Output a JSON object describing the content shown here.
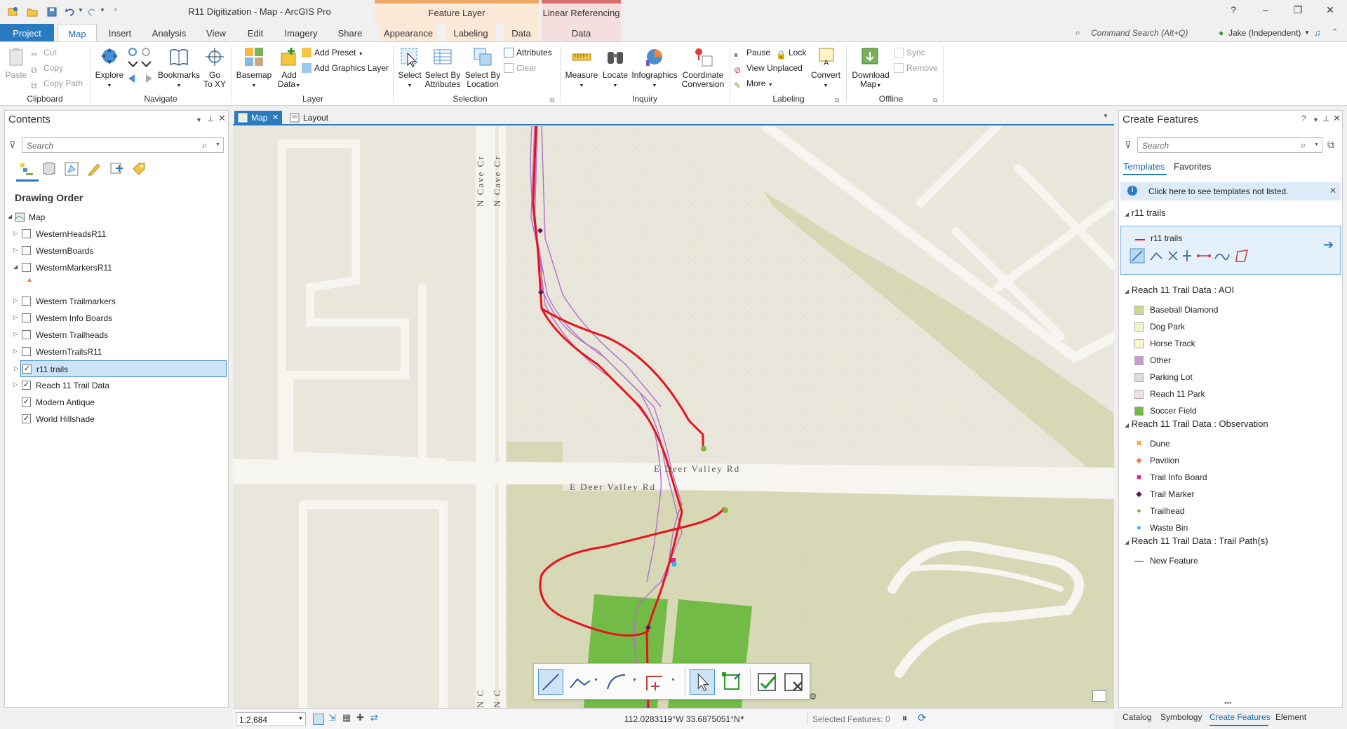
{
  "window": {
    "title": "R11 Digitization - Map - ArcGIS Pro",
    "context_feature_layer": "Feature Layer",
    "context_linear_ref": "Linear Referencing",
    "help": "?",
    "minimize": "–",
    "restore": "❐",
    "close": "✕"
  },
  "tabs": {
    "project": "Project",
    "map": "Map",
    "insert": "Insert",
    "analysis": "Analysis",
    "view": "View",
    "edit": "Edit",
    "imagery": "Imagery",
    "share": "Share",
    "appearance": "Appearance",
    "labeling": "Labeling",
    "data": "Data",
    "lr_data": "Data"
  },
  "command_search": {
    "placeholder": "Command Search (Alt+Q)"
  },
  "user": {
    "name": "Jake (Independent)"
  },
  "ribbon": {
    "clipboard": {
      "label": "Clipboard",
      "paste": "Paste",
      "cut": "Cut",
      "copy": "Copy",
      "copy_path": "Copy Path"
    },
    "navigate": {
      "label": "Navigate",
      "explore": "Explore",
      "bookmarks": "Bookmarks",
      "goto": "Go",
      "goto2": "To XY"
    },
    "layer": {
      "label": "Layer",
      "basemap": "Basemap",
      "add_data": "Add",
      "add_data2": "Data",
      "add_preset": "Add Preset",
      "add_graphics": "Add Graphics Layer"
    },
    "selection": {
      "label": "Selection",
      "select": "Select",
      "by_attr": "Select By",
      "by_attr2": "Attributes",
      "by_loc": "Select By",
      "by_loc2": "Location",
      "attributes": "Attributes",
      "clear": "Clear"
    },
    "inquiry": {
      "label": "Inquiry",
      "measure": "Measure",
      "locate": "Locate",
      "infographics": "Infographics",
      "coord": "Coordinate",
      "coord2": "Conversion"
    },
    "labeling": {
      "label": "Labeling",
      "pause": "Pause",
      "lock": "Lock",
      "view_unplaced": "View Unplaced",
      "more": "More",
      "convert": "Convert"
    },
    "offline": {
      "label": "Offline",
      "download": "Download",
      "download2": "Map",
      "sync": "Sync",
      "remove": "Remove"
    }
  },
  "contents": {
    "title": "Contents",
    "search_placeholder": "Search",
    "drawing_order": "Drawing Order",
    "map_node": "Map",
    "layers": [
      {
        "name": "WesternHeadsR11",
        "checked": false,
        "expanded": false
      },
      {
        "name": "WesternBoards",
        "checked": false,
        "expanded": false
      },
      {
        "name": "WesternMarkersR11",
        "checked": false,
        "expanded": true
      },
      {
        "name": "Western Trailmarkers",
        "checked": false,
        "expanded": false
      },
      {
        "name": "Western Info Boards",
        "checked": false,
        "expanded": false
      },
      {
        "name": "Western Trailheads",
        "checked": false,
        "expanded": false
      },
      {
        "name": "WesternTrailsR11",
        "checked": false,
        "expanded": false
      },
      {
        "name": "r11 trails",
        "checked": true,
        "expanded": false,
        "selected": true
      },
      {
        "name": "Reach 11 Trail Data",
        "checked": true,
        "expanded": false
      },
      {
        "name": "Modern Antique",
        "checked": true,
        "expanded": null
      },
      {
        "name": "World Hillshade",
        "checked": true,
        "expanded": null
      }
    ]
  },
  "view_tabs": {
    "map": "Map",
    "layout": "Layout"
  },
  "map": {
    "road_labels": [
      "E Deer Valley Rd",
      "E Deer Valley Rd",
      "N Cave Cr",
      "N Cave Cr",
      "N C",
      "N C"
    ],
    "colors": {
      "trail": "#e8121b",
      "path": "#b070c8",
      "park": "#d7d9b6",
      "field": "#72bb46",
      "road": "#f7f5ef",
      "ground": "#e9e6dc"
    }
  },
  "status": {
    "scale": "1:2,684",
    "coords": "112.0283119°W 33.6875051°N",
    "selected": "Selected Features: 0"
  },
  "create_features": {
    "title": "Create Features",
    "search_placeholder": "Search",
    "tab_templates": "Templates",
    "tab_favorites": "Favorites",
    "info": "Click here to see templates not listed.",
    "group_r11": "r11 trails",
    "r11_template": "r11 trails",
    "group_aoi": "Reach 11 Trail Data : AOI",
    "aoi": [
      {
        "name": "Baseball Diamond",
        "color": "#cbd98a"
      },
      {
        "name": "Dog Park",
        "color": "#eef5c7"
      },
      {
        "name": "Horse Track",
        "color": "#fbf5cc"
      },
      {
        "name": "Other",
        "color": "#c69ccf"
      },
      {
        "name": "Parking Lot",
        "color": "#dcdcdc"
      },
      {
        "name": "Reach 11 Park",
        "color": "#efe2e6"
      },
      {
        "name": "Soccer Field",
        "color": "#72bb46"
      }
    ],
    "group_obs": "Reach 11 Trail Data : Observation",
    "obs": [
      {
        "name": "Dune",
        "color": "#f0a030",
        "icon": "x-mark-icon"
      },
      {
        "name": "Pavilion",
        "color": "#f08060",
        "icon": "diamond-icon"
      },
      {
        "name": "Trail Info Board",
        "color": "#e0208a",
        "icon": "square-icon"
      },
      {
        "name": "Trail Marker",
        "color": "#601850",
        "icon": "diamond-icon"
      },
      {
        "name": "Trailhead",
        "color": "#7ab83a",
        "icon": "circle-icon"
      },
      {
        "name": "Waste Bin",
        "color": "#20b8e8",
        "icon": "circle-icon"
      }
    ],
    "group_path": "Reach 11 Trail Data : Trail Path(s)",
    "path": [
      {
        "name": "New Feature",
        "color": "#c080c8"
      }
    ]
  },
  "bottom_tabs": {
    "catalog": "Catalog",
    "symbology": "Symbology",
    "create": "Create Features",
    "element": "Element"
  }
}
